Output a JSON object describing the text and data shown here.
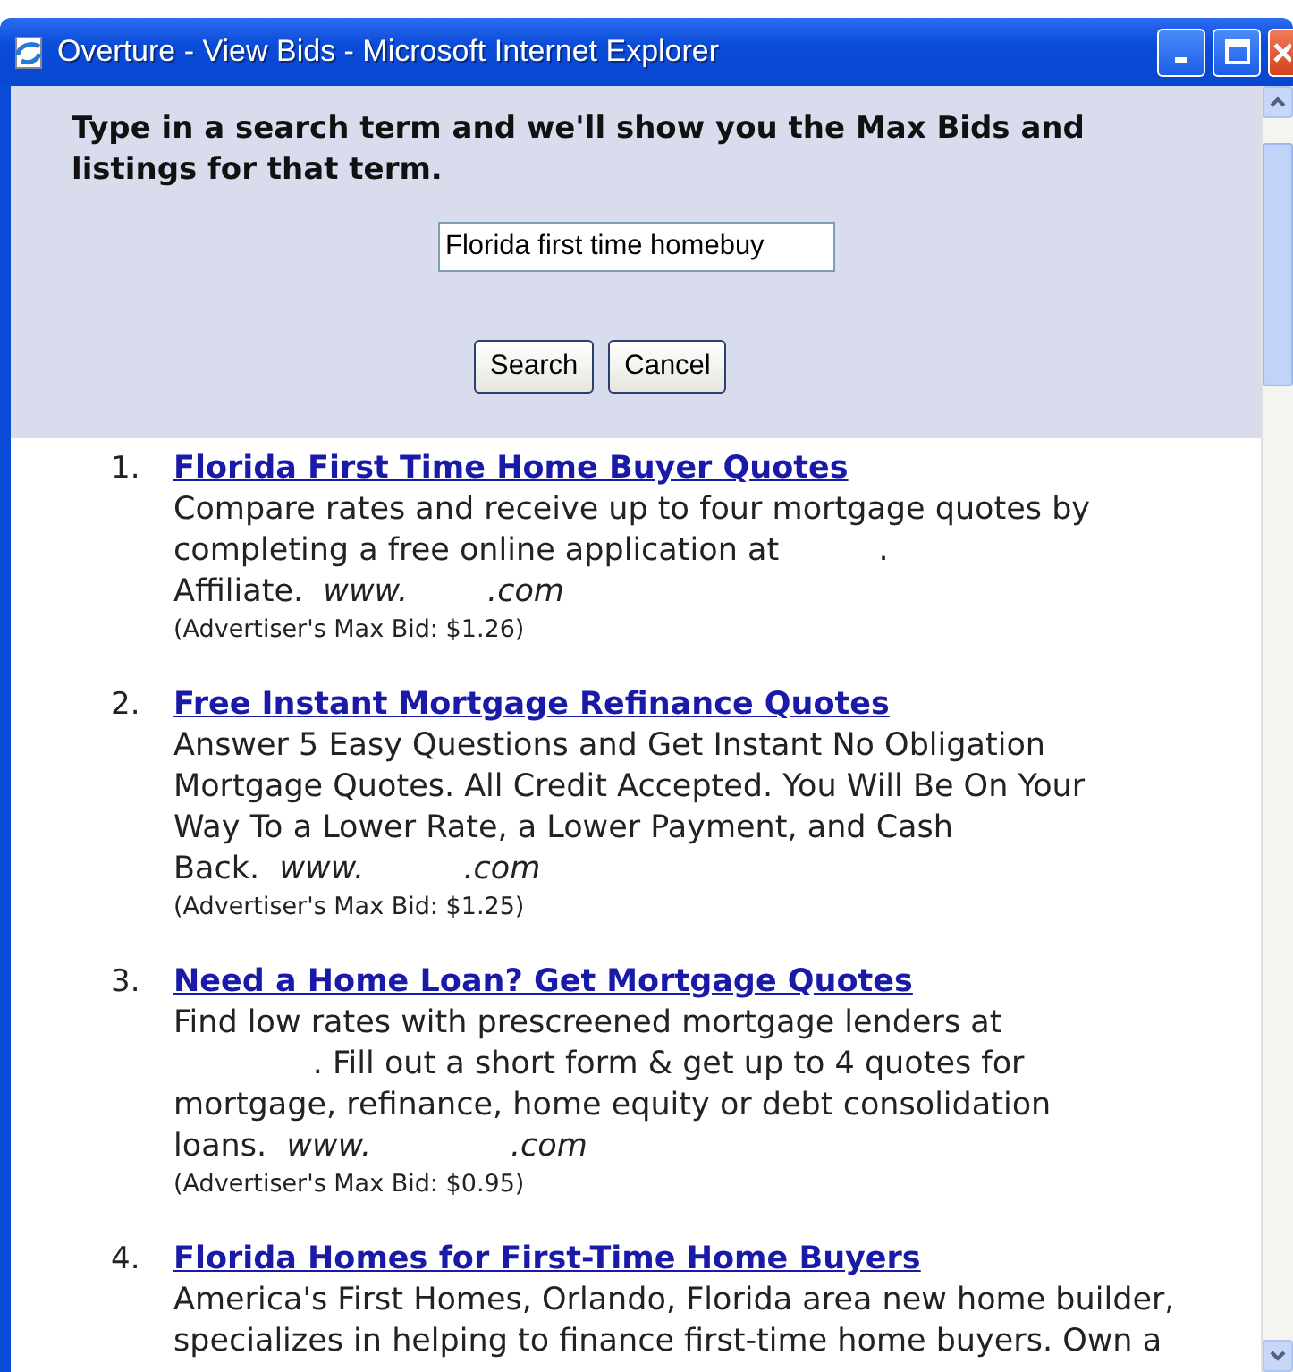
{
  "window": {
    "title": "Overture - View Bids - Microsoft Internet Explorer"
  },
  "search_panel": {
    "prompt": "Type in a search term and we'll show you the Max Bids and listings for that term.",
    "search_field": {
      "value": "Florida first time homebuy"
    },
    "buttons": [
      "Search",
      "Cancel"
    ]
  },
  "listings": [
    {
      "number": "1.",
      "title": "Florida First Time Home Buyer Quotes",
      "description": [
        "Compare rates and receive up to four mortgage quotes by",
        "completing a free online application at          .",
        "Affiliate.  *www.        .com*"
      ],
      "max_bid": "(Advertiser's Max Bid: $1.26)"
    },
    {
      "number": "2.",
      "title": "Free Instant Mortgage Refinance Quotes",
      "description": [
        "Answer 5 Easy Questions and Get Instant No Obligation",
        "Mortgage Quotes. All Credit Accepted. You Will Be On Your",
        "Way To a Lower Rate, a Lower Payment, and Cash",
        "Back.  *www.          .com*"
      ],
      "max_bid": "(Advertiser's Max Bid: $1.25)"
    },
    {
      "number": "3.",
      "title": "Need a Home Loan? Get Mortgage Quotes",
      "description": [
        "Find low rates with prescreened mortgage lenders at",
        "              . Fill out a short form & get up to 4 quotes for",
        "mortgage, refinance, home equity or debt consolidation",
        "loans.  *www.              .com*"
      ],
      "max_bid": "(Advertiser's Max Bid: $0.95)"
    },
    {
      "number": "4.",
      "title": "Florida Homes for First-Time Home Buyers",
      "description": [
        "America's First Homes, Orlando, Florida area new home builder,",
        "specializes in helping to finance first-time home buyers. Own a"
      ]
    }
  ]
}
